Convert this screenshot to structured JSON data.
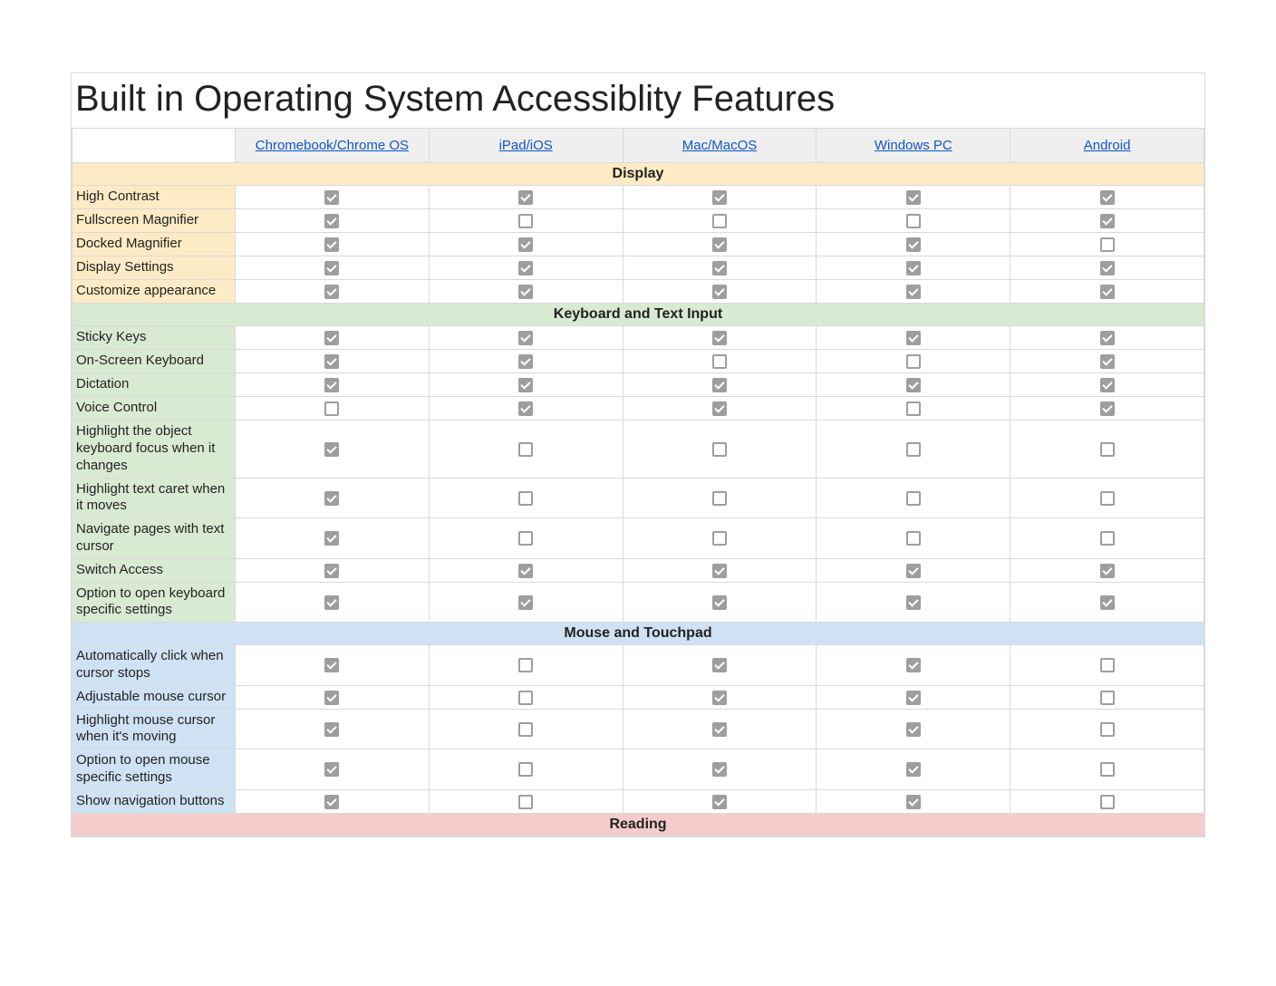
{
  "title": "Built in Operating System Accessiblity Features",
  "columns": [
    "Chromebook/Chrome OS",
    "iPad/iOS",
    "Mac/MacOS",
    "Windows PC",
    "Android"
  ],
  "sections": [
    {
      "heading": "Display",
      "class": "sec-display",
      "labelClass": "l-display",
      "rows": [
        {
          "label": "High Contrast",
          "v": [
            true,
            true,
            true,
            true,
            true
          ]
        },
        {
          "label": "Fullscreen Magnifier",
          "v": [
            true,
            false,
            false,
            false,
            true
          ]
        },
        {
          "label": "Docked Magnifier",
          "v": [
            true,
            true,
            true,
            true,
            false
          ]
        },
        {
          "label": "Display Settings",
          "v": [
            true,
            true,
            true,
            true,
            true
          ]
        },
        {
          "label": "Customize appearance",
          "v": [
            true,
            true,
            true,
            true,
            true
          ]
        }
      ]
    },
    {
      "heading": "Keyboard and Text Input",
      "class": "sec-keyboard",
      "labelClass": "l-keyboard",
      "rows": [
        {
          "label": "Sticky Keys",
          "v": [
            true,
            true,
            true,
            true,
            true
          ]
        },
        {
          "label": "On-Screen Keyboard",
          "v": [
            true,
            true,
            false,
            false,
            true
          ]
        },
        {
          "label": "Dictation",
          "v": [
            true,
            true,
            true,
            true,
            true
          ]
        },
        {
          "label": "Voice Control",
          "v": [
            false,
            true,
            true,
            false,
            true
          ]
        },
        {
          "label": "Highlight the object keyboard focus when it changes",
          "v": [
            true,
            false,
            false,
            false,
            false
          ]
        },
        {
          "label": "Highlight text caret when it moves",
          "v": [
            true,
            false,
            false,
            false,
            false
          ]
        },
        {
          "label": "Navigate pages with text cursor",
          "v": [
            true,
            false,
            false,
            false,
            false
          ]
        },
        {
          "label": "Switch Access",
          "v": [
            true,
            true,
            true,
            true,
            true
          ]
        },
        {
          "label": "Option to open keyboard specific settings",
          "v": [
            true,
            true,
            true,
            true,
            true
          ]
        }
      ]
    },
    {
      "heading": "Mouse and Touchpad",
      "class": "sec-mouse",
      "labelClass": "l-mouse",
      "rows": [
        {
          "label": "Automatically click when cursor stops",
          "v": [
            true,
            false,
            true,
            true,
            false
          ]
        },
        {
          "label": "Adjustable mouse cursor",
          "v": [
            true,
            false,
            true,
            true,
            false
          ]
        },
        {
          "label": "Highlight mouse cursor when it's moving",
          "v": [
            true,
            false,
            true,
            true,
            false
          ]
        },
        {
          "label": "Option to open mouse specific settings",
          "v": [
            true,
            false,
            true,
            true,
            false
          ]
        },
        {
          "label": "Show navigation buttons",
          "v": [
            true,
            false,
            true,
            true,
            false
          ]
        }
      ]
    },
    {
      "heading": "Reading",
      "class": "sec-reading",
      "labelClass": "",
      "rows": []
    }
  ]
}
